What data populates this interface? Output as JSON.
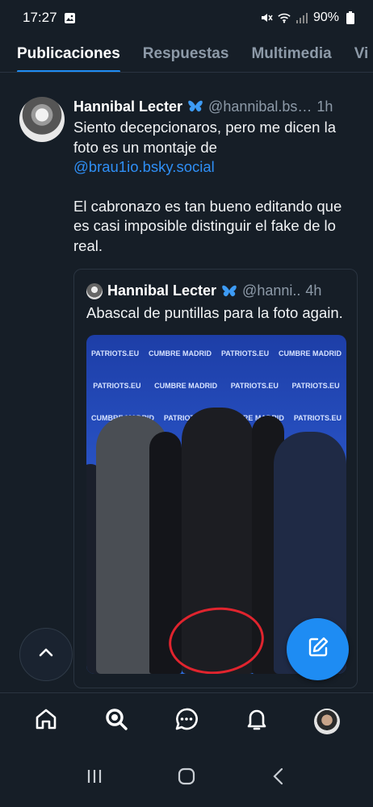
{
  "status_bar": {
    "time": "17:27",
    "battery": "90%"
  },
  "tabs": [
    {
      "label": "Publicaciones",
      "active": true
    },
    {
      "label": "Respuestas",
      "active": false
    },
    {
      "label": "Multimedia",
      "active": false
    },
    {
      "label": "Vi",
      "active": false
    }
  ],
  "post": {
    "author": "Hannibal Lecter",
    "handle": "@hannibal.bs…",
    "ago": "1h",
    "text_line1": "Siento decepcionaros, pero me dicen la foto es un montaje de",
    "mention": "@brau1io.bsky.social",
    "text_paragraph2": "El cabronazo es tan bueno editando que es casi imposible distinguir el fake de lo real."
  },
  "quote": {
    "author": "Hannibal Lecter",
    "handle": "@hanni..",
    "ago": "4h",
    "text": "Abascal de puntillas para la foto again."
  },
  "photo_banner": {
    "brand_a": "PATRIOTS.EU",
    "brand_b": "CUMBRE MADRID"
  },
  "colors": {
    "background": "#161e27",
    "accent": "#1e8cf3",
    "muted": "#8d9aa8",
    "annotation": "#e0242e"
  },
  "icons": {
    "scroll_top": "chevron-up-icon",
    "compose": "pencil-square-icon",
    "nav": [
      "home-icon",
      "search-icon",
      "chat-icon",
      "bell-icon",
      "profile-avatar"
    ]
  }
}
